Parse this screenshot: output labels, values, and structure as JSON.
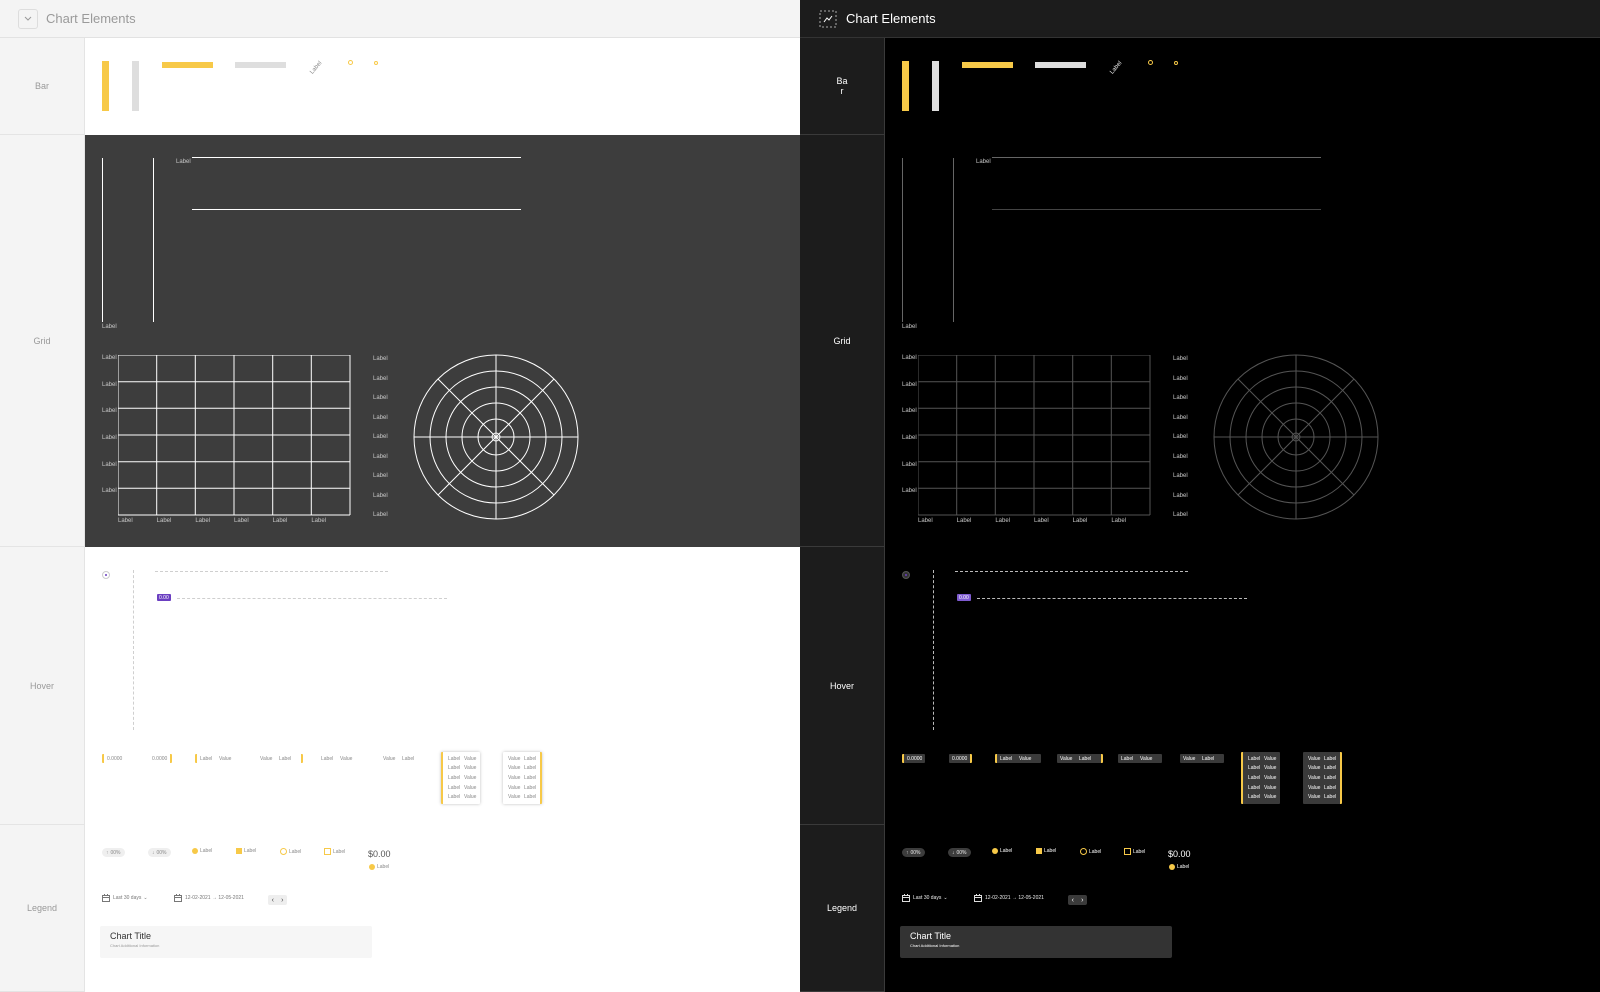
{
  "title": "Chart Elements",
  "sections": {
    "bar": "Bar",
    "bar_dark": "Ba\nr",
    "grid": "Grid",
    "hover": "Hover",
    "legend": "Legend"
  },
  "axis_label": "Label",
  "value_label": "Value",
  "number_value": "0.0000",
  "badge_value": "0.00",
  "up_change": "00%",
  "down_change": "00%",
  "money": "$0.00",
  "date_range_select": "Last 30 days",
  "date_range": "12-02-2021 → 12-05-2021",
  "chart_title": "Chart Title",
  "chart_subtitle": "Chart Additional Information",
  "icons": {
    "collapse": "chevron-down-icon",
    "chart": "line-chart-icon",
    "calendar": "calendar-icon",
    "prev": "chevron-left-icon",
    "next": "chevron-right-icon",
    "up": "arrow-up-icon",
    "down": "arrow-down-icon"
  },
  "colors": {
    "accent": "#f7c948",
    "gray_bar": "#dedede",
    "badge": "#6b3fc1",
    "grid_bg": "#3d3d3d",
    "dark_bg": "#000000"
  }
}
